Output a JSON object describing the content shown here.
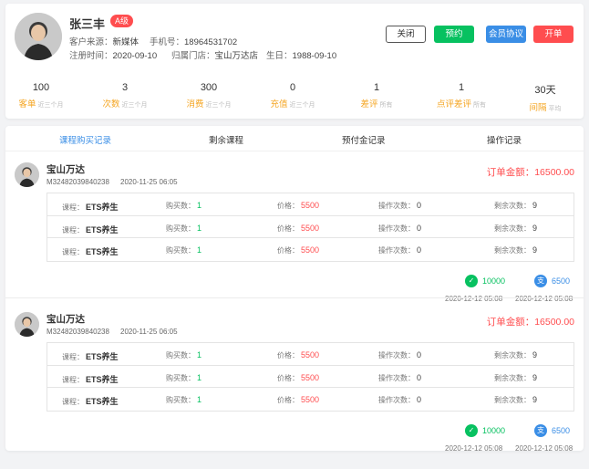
{
  "profile": {
    "name": "张三丰",
    "level": "A级",
    "source_label": "客户来源：",
    "source": "新媒体",
    "phone_label": "手机号：",
    "phone": "18964531702",
    "register_label": "注册时间：",
    "register_date": "2020-09-10",
    "store_label": "归属门店：",
    "store": "宝山万达店",
    "birthday_label": "生日：",
    "birthday": "1988-09-10"
  },
  "actions": {
    "close": "关闭",
    "book": "预约",
    "agreement": "会员协议",
    "open_order": "开单"
  },
  "stats": [
    {
      "value": "100",
      "label": "客单",
      "sub": "近三个月"
    },
    {
      "value": "3",
      "label": "次数",
      "sub": "近三个月"
    },
    {
      "value": "300",
      "label": "消费",
      "sub": "近三个月"
    },
    {
      "value": "0",
      "label": "充值",
      "sub": "近三个月"
    },
    {
      "value": "1",
      "label": "差评",
      "sub": "所有"
    },
    {
      "value": "1",
      "label": "点评差评",
      "sub": "所有"
    },
    {
      "value": "30天",
      "label": "间隔",
      "sub": "平均"
    }
  ],
  "tabs": [
    "课程购买记录",
    "剩余课程",
    "预付金记录",
    "操作记录"
  ],
  "labels": {
    "course": "课程：",
    "bought": "购买数：",
    "price": "价格：",
    "ops": "操作次数：",
    "remaining": "剩余次数："
  },
  "orders": [
    {
      "store": "宝山万达",
      "order_no": "M32482039840238",
      "time": "2020-11-25  06:05",
      "amount": "订单金额：16500.00",
      "items": [
        {
          "course": "ETS养生",
          "bought": "1",
          "price": "5500",
          "ops": "0",
          "remaining": "9"
        },
        {
          "course": "ETS养生",
          "bought": "1",
          "price": "5500",
          "ops": "0",
          "remaining": "9"
        },
        {
          "course": "ETS养生",
          "bought": "1",
          "price": "5500",
          "ops": "0",
          "remaining": "9"
        }
      ],
      "payments": [
        {
          "method": "wechat-icon",
          "amount": "10000",
          "time": "2020-12-12 05:08",
          "color": "#07c160"
        },
        {
          "method": "alipay-icon",
          "amount": "6500",
          "time": "2020-12-12 05:08",
          "color": "#3a8ee6"
        }
      ]
    },
    {
      "store": "宝山万达",
      "order_no": "M32482039840238",
      "time": "2020-11-25  06:05",
      "amount": "订单金额：16500.00",
      "items": [
        {
          "course": "ETS养生",
          "bought": "1",
          "price": "5500",
          "ops": "0",
          "remaining": "9"
        },
        {
          "course": "ETS养生",
          "bought": "1",
          "price": "5500",
          "ops": "0",
          "remaining": "9"
        },
        {
          "course": "ETS养生",
          "bought": "1",
          "price": "5500",
          "ops": "0",
          "remaining": "9"
        }
      ],
      "payments": [
        {
          "method": "wechat-icon",
          "amount": "10000",
          "time": "2020-12-12 05:08",
          "color": "#07c160"
        },
        {
          "method": "alipay-icon",
          "amount": "6500",
          "time": "2020-12-12 05:08",
          "color": "#3a8ee6"
        }
      ]
    }
  ],
  "colors": {
    "accent": "#3a8ee6",
    "danger": "#ff4d4f",
    "success": "#07c160",
    "warning": "#f5a623"
  }
}
